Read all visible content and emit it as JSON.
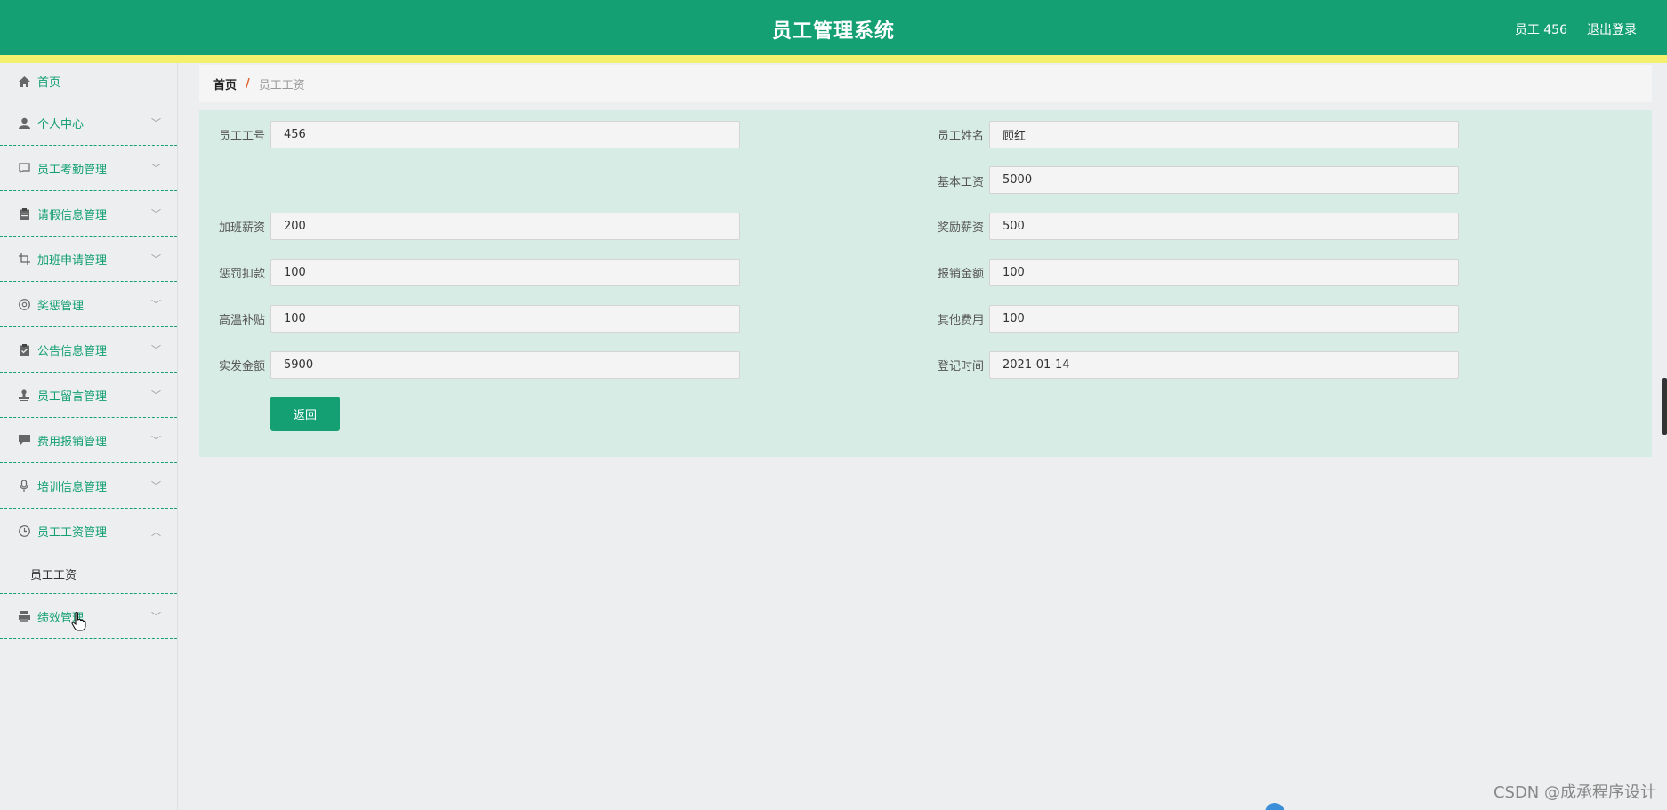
{
  "header": {
    "title": "员工管理系统",
    "user": "员工 456",
    "logout": "退出登录",
    "colors": {
      "primary": "#14a072",
      "stripe": "#f2f06c"
    }
  },
  "sidebar": {
    "items": [
      {
        "label": "首页",
        "icon": "home-icon"
      },
      {
        "label": "个人中心",
        "icon": "user-icon"
      },
      {
        "label": "员工考勤管理",
        "icon": "chat-icon"
      },
      {
        "label": "请假信息管理",
        "icon": "clipboard-icon"
      },
      {
        "label": "加班申请管理",
        "icon": "crop-icon"
      },
      {
        "label": "奖惩管理",
        "icon": "aperture-icon"
      },
      {
        "label": "公告信息管理",
        "icon": "clipboard-check-icon"
      },
      {
        "label": "员工留言管理",
        "icon": "stamp-icon"
      },
      {
        "label": "费用报销管理",
        "icon": "message-icon"
      },
      {
        "label": "培训信息管理",
        "icon": "microphone-icon"
      },
      {
        "label": "员工工资管理",
        "icon": "clock-icon"
      },
      {
        "label": "绩效管理",
        "icon": "printer-icon"
      }
    ],
    "submenu": {
      "label": "员工工资"
    }
  },
  "breadcrumb": {
    "home": "首页",
    "separator": "/",
    "current": "员工工资"
  },
  "form": {
    "employee_no": {
      "label": "员工工号",
      "value": "456"
    },
    "employee_name": {
      "label": "员工姓名",
      "value": "顾红"
    },
    "base_salary": {
      "label": "基本工资",
      "value": "5000"
    },
    "overtime_pay": {
      "label": "加班薪资",
      "value": "200"
    },
    "bonus_pay": {
      "label": "奖励薪资",
      "value": "500"
    },
    "penalty": {
      "label": "惩罚扣款",
      "value": "100"
    },
    "reimbursement": {
      "label": "报销金额",
      "value": "100"
    },
    "heat_allowance": {
      "label": "高温补贴",
      "value": "100"
    },
    "other_fees": {
      "label": "其他费用",
      "value": "100"
    },
    "net_pay": {
      "label": "实发金额",
      "value": "5900"
    },
    "record_date": {
      "label": "登记时间",
      "value": "2021-01-14"
    },
    "back_label": "返回"
  },
  "watermark": "CSDN @成承程序设计"
}
